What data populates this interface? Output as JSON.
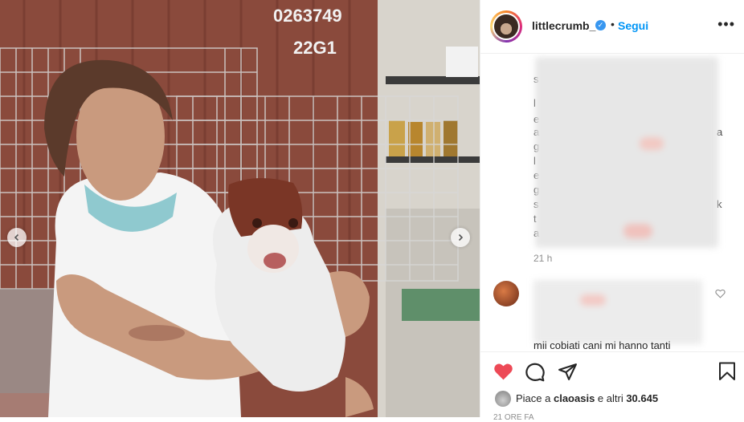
{
  "post": {
    "username": "littlecrumb_",
    "follow_label": "Segui",
    "dot": "•",
    "more_label": "•••",
    "verified_mark": "✓"
  },
  "photo": {
    "container_code_line1": "0263749",
    "container_code_line2": "22G1"
  },
  "comments": {
    "caption_fragments": [
      "s",
      "l",
      "e",
      "a",
      "g",
      "l",
      "e",
      "g",
      "s",
      "t",
      "a"
    ],
    "caption_right_fragments": [
      "a",
      "k"
    ],
    "time_ago": "21 h",
    "cut_text": "mii cobiati cani mi hanno tanti"
  },
  "actions": {
    "likes_prefix": "Piace a ",
    "likes_user": "claoasis",
    "likes_middle": " e altri ",
    "likes_count": "30.645",
    "date_cut": "21 ORE FA"
  },
  "colors": {
    "accent": "#0095f6",
    "liked": "#ed4956",
    "verified": "#3897f0"
  },
  "icons": [
    "verified-icon",
    "more-icon",
    "heart-icon",
    "comment-icon",
    "share-icon",
    "bookmark-icon",
    "chevron-left-icon",
    "chevron-right-icon"
  ]
}
